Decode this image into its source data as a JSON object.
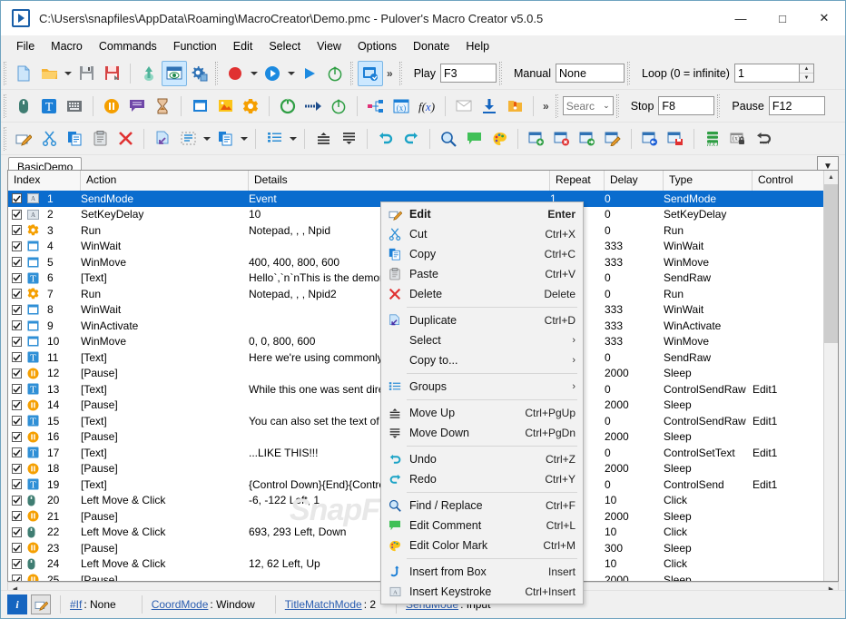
{
  "window": {
    "title": "C:\\Users\\snapfiles\\AppData\\Roaming\\MacroCreator\\Demo.pmc - Pulover's Macro Creator v5.0.5",
    "minimize": "—",
    "maximize": "□",
    "close": "✕"
  },
  "menubar": {
    "items": [
      "File",
      "Macro",
      "Commands",
      "Function",
      "Edit",
      "Select",
      "View",
      "Options",
      "Donate",
      "Help"
    ]
  },
  "toolbar1": {
    "icons": [
      "new-file-icon",
      "open-folder-icon",
      "save-icon",
      "save-as-icon",
      "export-icon",
      "preview-icon",
      "settings-icon",
      "record-icon",
      "play-dropdown-icon",
      "play-icon",
      "timer-icon",
      "capture-window-icon"
    ],
    "overflow": "»",
    "play_label": "Play",
    "play_value": "F3",
    "manual_label": "Manual",
    "manual_value": "None",
    "loop_label": "Loop (0 = infinite)",
    "loop_value": "1"
  },
  "toolbar2": {
    "icons": [
      "mouse-icon",
      "text-icon",
      "keyboard-icon",
      "pause-icon",
      "comment-icon",
      "hourglass-icon",
      "window-icon",
      "image-icon",
      "control-icon",
      "loop-icon",
      "goto-icon",
      "timer-icon",
      "flow-icon",
      "variable-icon",
      "function-icon",
      "message-icon",
      "download-icon",
      "file-icon"
    ],
    "overflow": "»",
    "search_placeholder": "Searc",
    "stop_label": "Stop",
    "stop_value": "F8",
    "pause_label": "Pause",
    "pause_value": "F12"
  },
  "toolbar3": {
    "icons": [
      "edit-icon",
      "cut-icon",
      "copy-icon",
      "paste-icon",
      "delete-icon",
      "duplicate-icon",
      "select-dashed-icon",
      "copy-to-icon",
      "groups-icon",
      "move-up-icon",
      "move-down-icon",
      "undo-icon",
      "redo-icon",
      "find-replace-icon",
      "edit-comment-icon",
      "color-mark-icon",
      "insert-row-icon",
      "remove-row-icon",
      "move-row-icon",
      "edit-row-icon",
      "insert-before-icon",
      "save-row-icon",
      "variables-fx-icon",
      "lock-var-icon",
      "restore-icon"
    ]
  },
  "tabs": {
    "items": [
      {
        "label": "BasicDemo",
        "active": true
      }
    ],
    "dropdown_icon": "chevron-down-icon"
  },
  "grid": {
    "columns": [
      "Index",
      "Action",
      "Details",
      "Repeat",
      "Delay",
      "Type",
      "Control"
    ],
    "rows": [
      {
        "checked": true,
        "icon": "keystroke",
        "index": "1",
        "action": "SendMode",
        "details": "Event",
        "repeat": "1",
        "delay": "0",
        "type": "SendMode",
        "control": "",
        "selected": true
      },
      {
        "checked": true,
        "icon": "keystroke",
        "index": "2",
        "action": "SetKeyDelay",
        "details": "10",
        "repeat": "",
        "delay": "0",
        "type": "SetKeyDelay",
        "control": ""
      },
      {
        "checked": true,
        "icon": "control",
        "index": "3",
        "action": "Run",
        "details": "Notepad, , , Npid",
        "repeat": "",
        "delay": "0",
        "type": "Run",
        "control": ""
      },
      {
        "checked": true,
        "icon": "window",
        "index": "4",
        "action": "WinWait",
        "details": "",
        "repeat": "",
        "delay": "333",
        "type": "WinWait",
        "control": ""
      },
      {
        "checked": true,
        "icon": "window",
        "index": "5",
        "action": "WinMove",
        "details": "400, 400, 800, 600",
        "repeat": "",
        "delay": "333",
        "type": "WinMove",
        "control": ""
      },
      {
        "checked": true,
        "icon": "text",
        "index": "6",
        "action": "[Text]",
        "details": "Hello`,`n`nThis is the demonstrati",
        "repeat": "",
        "delay": "0",
        "type": "SendRaw",
        "control": ""
      },
      {
        "checked": true,
        "icon": "control",
        "index": "7",
        "action": "Run",
        "details": "Notepad, , , Npid2",
        "repeat": "",
        "delay": "0",
        "type": "Run",
        "control": ""
      },
      {
        "checked": true,
        "icon": "window",
        "index": "8",
        "action": "WinWait",
        "details": "",
        "repeat": "",
        "delay": "333",
        "type": "WinWait",
        "control": ""
      },
      {
        "checked": true,
        "icon": "window",
        "index": "9",
        "action": "WinActivate",
        "details": "",
        "repeat": "",
        "delay": "333",
        "type": "WinActivate",
        "control": ""
      },
      {
        "checked": true,
        "icon": "window",
        "index": "10",
        "action": "WinMove",
        "details": "0, 0, 800, 600",
        "repeat": "",
        "delay": "333",
        "type": "WinMove",
        "control": ""
      },
      {
        "checked": true,
        "icon": "text",
        "index": "11",
        "action": "[Text]",
        "details": "Here we're using commonly used",
        "repeat": "",
        "delay": "0",
        "type": "SendRaw",
        "control": ""
      },
      {
        "checked": true,
        "icon": "pause",
        "index": "12",
        "action": "[Pause]",
        "details": "",
        "repeat": "",
        "delay": "2000",
        "type": "Sleep",
        "control": ""
      },
      {
        "checked": true,
        "icon": "text",
        "index": "13",
        "action": "[Text]",
        "details": "While this one was sent directly t",
        "repeat": "",
        "delay": "0",
        "type": "ControlSendRaw",
        "control": "Edit1"
      },
      {
        "checked": true,
        "icon": "pause",
        "index": "14",
        "action": "[Pause]",
        "details": "",
        "repeat": "",
        "delay": "2000",
        "type": "Sleep",
        "control": ""
      },
      {
        "checked": true,
        "icon": "text",
        "index": "15",
        "action": "[Text]",
        "details": "You can also set the text of the e",
        "repeat": "",
        "delay": "0",
        "type": "ControlSendRaw",
        "control": "Edit1"
      },
      {
        "checked": true,
        "icon": "pause",
        "index": "16",
        "action": "[Pause]",
        "details": "",
        "repeat": "",
        "delay": "2000",
        "type": "Sleep",
        "control": ""
      },
      {
        "checked": true,
        "icon": "text",
        "index": "17",
        "action": "[Text]",
        "details": "...LIKE THIS!!!",
        "repeat": "",
        "delay": "0",
        "type": "ControlSetText",
        "control": "Edit1"
      },
      {
        "checked": true,
        "icon": "pause",
        "index": "18",
        "action": "[Pause]",
        "details": "",
        "repeat": "",
        "delay": "2000",
        "type": "Sleep",
        "control": ""
      },
      {
        "checked": true,
        "icon": "text",
        "index": "19",
        "action": "[Text]",
        "details": "{Control Down}{End}{Control UP",
        "repeat": "",
        "delay": "0",
        "type": "ControlSend",
        "control": "Edit1"
      },
      {
        "checked": true,
        "icon": "mouse",
        "index": "20",
        "action": "Left Move & Click",
        "details": "-6, -122 Left, 1",
        "repeat": "",
        "delay": "10",
        "type": "Click",
        "control": ""
      },
      {
        "checked": true,
        "icon": "pause",
        "index": "21",
        "action": "[Pause]",
        "details": "",
        "repeat": "",
        "delay": "2000",
        "type": "Sleep",
        "control": ""
      },
      {
        "checked": true,
        "icon": "mouse",
        "index": "22",
        "action": "Left Move & Click",
        "details": "693, 293 Left, Down",
        "repeat": "",
        "delay": "10",
        "type": "Click",
        "control": ""
      },
      {
        "checked": true,
        "icon": "pause",
        "index": "23",
        "action": "[Pause]",
        "details": "",
        "repeat": "",
        "delay": "300",
        "type": "Sleep",
        "control": ""
      },
      {
        "checked": true,
        "icon": "mouse",
        "index": "24",
        "action": "Left Move & Click",
        "details": "12, 62 Left, Up",
        "repeat": "",
        "delay": "10",
        "type": "Click",
        "control": ""
      },
      {
        "checked": true,
        "icon": "pause",
        "index": "25",
        "action": "[Pause]",
        "details": "",
        "repeat": "",
        "delay": "2000",
        "type": "Sleep",
        "control": ""
      }
    ]
  },
  "context_menu": {
    "items": [
      {
        "icon": "edit-icon",
        "label": "Edit",
        "accel": "Enter",
        "bold": true
      },
      {
        "icon": "cut-icon",
        "label": "Cut",
        "accel": "Ctrl+X"
      },
      {
        "icon": "copy-icon",
        "label": "Copy",
        "accel": "Ctrl+C"
      },
      {
        "icon": "paste-icon",
        "label": "Paste",
        "accel": "Ctrl+V"
      },
      {
        "icon": "delete-icon",
        "label": "Delete",
        "accel": "Delete"
      },
      {
        "separator": true
      },
      {
        "icon": "duplicate-icon",
        "label": "Duplicate",
        "accel": "Ctrl+D"
      },
      {
        "icon": "",
        "label": "Select",
        "accel": "",
        "submenu": true
      },
      {
        "icon": "",
        "label": "Copy to...",
        "accel": "",
        "submenu": true
      },
      {
        "separator": true
      },
      {
        "icon": "groups-icon",
        "label": "Groups",
        "accel": "",
        "submenu": true
      },
      {
        "separator": true
      },
      {
        "icon": "move-up-icon",
        "label": "Move Up",
        "accel": "Ctrl+PgUp"
      },
      {
        "icon": "move-down-icon",
        "label": "Move Down",
        "accel": "Ctrl+PgDn"
      },
      {
        "separator": true
      },
      {
        "icon": "undo-icon",
        "label": "Undo",
        "accel": "Ctrl+Z"
      },
      {
        "icon": "redo-icon",
        "label": "Redo",
        "accel": "Ctrl+Y"
      },
      {
        "separator": true
      },
      {
        "icon": "find-replace-icon",
        "label": "Find / Replace",
        "accel": "Ctrl+F"
      },
      {
        "icon": "edit-comment-icon",
        "label": "Edit Comment",
        "accel": "Ctrl+L"
      },
      {
        "icon": "color-mark-icon",
        "label": "Edit Color Mark",
        "accel": "Ctrl+M"
      },
      {
        "separator": true
      },
      {
        "icon": "insert-from-box-icon",
        "label": "Insert from Box",
        "accel": "Insert"
      },
      {
        "icon": "insert-keystroke-icon",
        "label": "Insert Keystroke",
        "accel": "Ctrl+Insert"
      }
    ]
  },
  "statusbar": {
    "info_icon": "i",
    "edit_icon": "edit-icon",
    "fields": [
      {
        "link": "#If",
        "value": ": None"
      },
      {
        "link": "CoordMode",
        "value": ": Window"
      },
      {
        "link": "TitleMatchMode",
        "value": ": 2"
      },
      {
        "link": "SendMode",
        "value": ": Input"
      }
    ]
  },
  "watermark": "SnapFiles"
}
